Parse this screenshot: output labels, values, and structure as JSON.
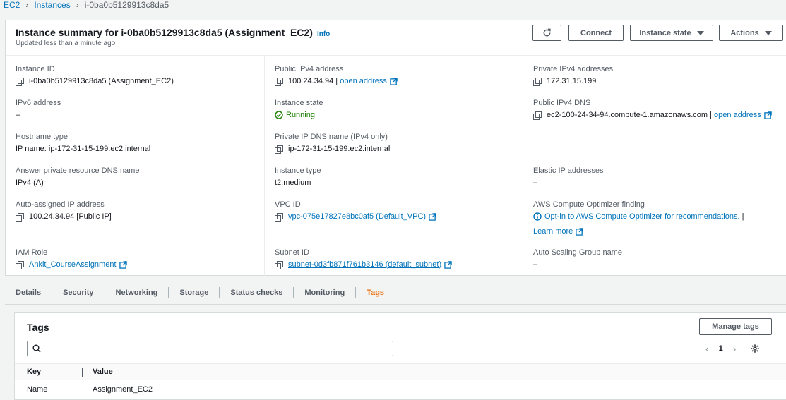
{
  "breadcrumb": {
    "ec2": "EC2",
    "instances": "Instances",
    "current": "i-0ba0b5129913c8da5"
  },
  "summary": {
    "title": "Instance summary for i-0ba0b5129913c8da5 (Assignment_EC2)",
    "info": "Info",
    "updated": "Updated less than a minute ago",
    "buttons": {
      "connect": "Connect",
      "instance_state": "Instance state",
      "actions": "Actions"
    }
  },
  "details": {
    "instance_id": {
      "label": "Instance ID",
      "value": "i-0ba0b5129913c8da5 (Assignment_EC2)"
    },
    "ipv6": {
      "label": "IPv6 address",
      "value": "–"
    },
    "hostname_type": {
      "label": "Hostname type",
      "value": "IP name: ip-172-31-15-199.ec2.internal"
    },
    "answer_dns": {
      "label": "Answer private resource DNS name",
      "value": "IPv4 (A)"
    },
    "auto_ip": {
      "label": "Auto-assigned IP address",
      "value": "100.24.34.94 [Public IP]"
    },
    "iam_role": {
      "label": "IAM Role",
      "value": "Ankit_CourseAssignment"
    },
    "public_ipv4": {
      "label": "Public IPv4 address",
      "value": "100.24.34.94",
      "sep": "|",
      "link": "open address"
    },
    "instance_state": {
      "label": "Instance state",
      "value": "Running"
    },
    "private_dns": {
      "label": "Private IP DNS name (IPv4 only)",
      "value": "ip-172-31-15-199.ec2.internal"
    },
    "instance_type": {
      "label": "Instance type",
      "value": "t2.medium"
    },
    "vpc_id": {
      "label": "VPC ID",
      "value": "vpc-075e17827e8bc0af5 (Default_VPC)"
    },
    "subnet_id": {
      "label": "Subnet ID",
      "value": "subnet-0d3fb871f761b3146 (default_subnet)"
    },
    "private_ipv4": {
      "label": "Private IPv4 addresses",
      "value": "172.31.15.199"
    },
    "public_dns": {
      "label": "Public IPv4 DNS",
      "value": "ec2-100-24-34-94.compute-1.amazonaws.com",
      "sep": "|",
      "link": "open address"
    },
    "elastic_ip": {
      "label": "Elastic IP addresses",
      "value": "–"
    },
    "optimizer": {
      "label": "AWS Compute Optimizer finding",
      "value": "Opt-in to AWS Compute Optimizer for recommendations.",
      "sep": "|",
      "learn_more": "Learn more"
    },
    "asg": {
      "label": "Auto Scaling Group name",
      "value": "–"
    }
  },
  "tabs": [
    "Details",
    "Security",
    "Networking",
    "Storage",
    "Status checks",
    "Monitoring",
    "Tags"
  ],
  "active_tab": "Tags",
  "tags": {
    "title": "Tags",
    "manage": "Manage tags",
    "search_placeholder": "",
    "page": "1",
    "columns": {
      "key": "Key",
      "value": "Value"
    },
    "rows": [
      {
        "key": "Name",
        "value": "Assignment_EC2"
      }
    ]
  },
  "colors": {
    "link": "#0073bb",
    "running": "#1d8102",
    "active_tab": "#ec7211"
  }
}
